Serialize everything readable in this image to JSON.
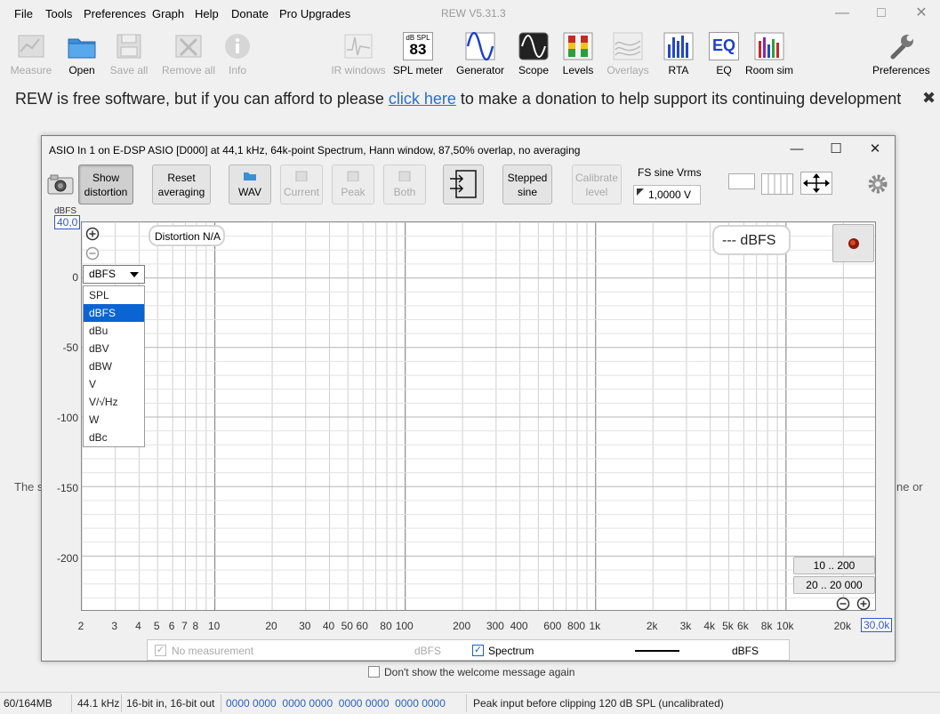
{
  "menu": [
    "File",
    "Tools",
    "Preferences",
    "Graph",
    "Help",
    "Donate",
    "Pro Upgrades"
  ],
  "app_title": "REW V5.31.3",
  "toolbar": [
    {
      "label": "Measure",
      "icon": "measure-icon",
      "enabled": false
    },
    {
      "label": "Open",
      "icon": "folder-icon",
      "enabled": true
    },
    {
      "label": "Save all",
      "icon": "save-icon",
      "enabled": false
    },
    {
      "label": "Remove all",
      "icon": "remove-icon",
      "enabled": false
    },
    {
      "label": "Info",
      "icon": "info-icon",
      "enabled": false
    },
    {
      "label": "IR windows",
      "icon": "ir-windows-icon",
      "enabled": false
    },
    {
      "label": "SPL meter",
      "icon": "spl-meter-icon",
      "enabled": true,
      "badge_top": "dB SPL",
      "badge_value": "83"
    },
    {
      "label": "Generator",
      "icon": "generator-icon",
      "enabled": true
    },
    {
      "label": "Scope",
      "icon": "scope-icon",
      "enabled": true
    },
    {
      "label": "Levels",
      "icon": "levels-icon",
      "enabled": true
    },
    {
      "label": "Overlays",
      "icon": "overlays-icon",
      "enabled": false
    },
    {
      "label": "RTA",
      "icon": "rta-icon",
      "enabled": true
    },
    {
      "label": "EQ",
      "icon": "eq-icon",
      "enabled": true,
      "badge_value": "EQ"
    },
    {
      "label": "Room sim",
      "icon": "room-sim-icon",
      "enabled": true
    },
    {
      "label": "Preferences",
      "icon": "wrench-icon",
      "enabled": true
    }
  ],
  "banner": {
    "before": "REW is free software, but if you can afford to please ",
    "link": "click here",
    "after": " to make a donation to help support its continuing development"
  },
  "background_text": {
    "left": "The s",
    "right": "ne or"
  },
  "rta_window": {
    "title": "ASIO In 1 on E-DSP ASIO [D000] at 44,1 kHz, 64k-point Spectrum, Hann window, 87,50% overlap, no averaging",
    "buttons": [
      {
        "label1": "Show",
        "label2": "distortion",
        "pressed": true,
        "enabled": true
      },
      {
        "label1": "Reset",
        "label2": "averaging",
        "pressed": false,
        "enabled": true
      },
      {
        "label1": "",
        "label2": "WAV",
        "pressed": false,
        "enabled": true
      },
      {
        "label1": "",
        "label2": "Current",
        "pressed": false,
        "enabled": false
      },
      {
        "label1": "",
        "label2": "Peak",
        "pressed": false,
        "enabled": false
      },
      {
        "label1": "",
        "label2": "Both",
        "pressed": false,
        "enabled": false
      },
      {
        "label1": "Stepped",
        "label2": "sine",
        "pressed": false,
        "enabled": true
      },
      {
        "label1": "Calibrate",
        "label2": "level",
        "pressed": false,
        "enabled": false
      }
    ],
    "fs_label": "FS sine Vrms",
    "fs_value": "1,0000 V",
    "y_unit": "dBFS",
    "y_top": "40,0",
    "y_ticks": [
      "0",
      "-50",
      "-100",
      "-150",
      "-200"
    ],
    "x_ticks": [
      "2",
      "3",
      "4",
      "5",
      "6",
      "7",
      "8",
      "10",
      "20",
      "30",
      "40",
      "50",
      "60",
      "80",
      "100",
      "200",
      "300",
      "400",
      "600",
      "800",
      "1k",
      "2k",
      "3k",
      "4k",
      "5k",
      "6k",
      "8k",
      "10k",
      "20k"
    ],
    "x_end": "30,0k",
    "distortion_label": "Distortion N/A",
    "level_readout": "--- dBFS",
    "unit_selected": "dBFS",
    "unit_options": [
      "SPL",
      "dBFS",
      "dBu",
      "dBV",
      "dBW",
      "V",
      "V/√Hz",
      "W",
      "dBc"
    ],
    "range_buttons": [
      "10 .. 200",
      "20 .. 20 000"
    ],
    "legend": {
      "no_measurement": "No measurement",
      "unit1": "dBFS",
      "spectrum": "Spectrum",
      "unit2": "dBFS"
    }
  },
  "welcome": "Don't show the welcome message again",
  "status": {
    "memory": "60/164MB",
    "rate": "44.1 kHz",
    "bits": "16-bit in, 16-bit out",
    "codes": "0000 0000  0000 0000  0000 0000  0000 0000",
    "peak": "Peak input before clipping 120 dB SPL (uncalibrated)"
  }
}
